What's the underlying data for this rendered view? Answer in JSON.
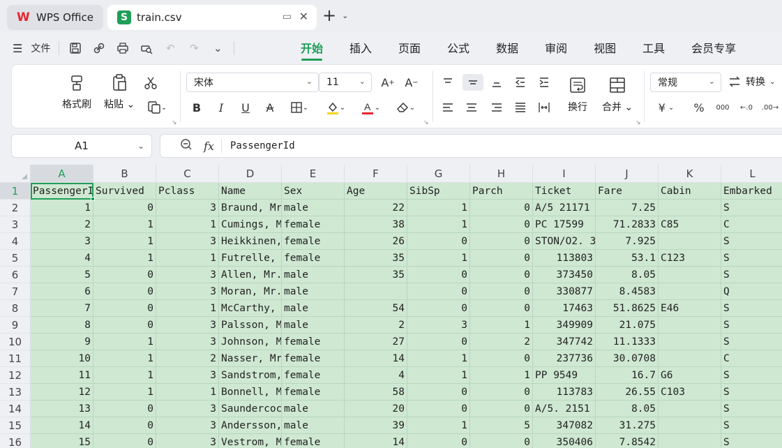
{
  "tabs": {
    "app": "WPS Office",
    "file": "train.csv"
  },
  "menu": {
    "file_label": "文件",
    "tabs": [
      "开始",
      "插入",
      "页面",
      "公式",
      "数据",
      "审阅",
      "视图",
      "工具",
      "会员专享"
    ],
    "active_tab": "开始"
  },
  "ribbon": {
    "format_painter": "格式刷",
    "paste": "粘贴",
    "font_name": "宋体",
    "font_size": "11",
    "wrap": "换行",
    "merge": "合并",
    "number_format": "常规",
    "convert": "转换",
    "currency": "¥",
    "percent": "%"
  },
  "formula_bar": {
    "name_box": "A1",
    "fx": "fx",
    "value": "PassengerId"
  },
  "sheet": {
    "columns": [
      "A",
      "B",
      "C",
      "D",
      "E",
      "F",
      "G",
      "H",
      "I",
      "J",
      "K",
      "L"
    ],
    "row_numbers": [
      "1",
      "2",
      "3",
      "4",
      "5",
      "6",
      "7",
      "8",
      "9",
      "10",
      "11",
      "12",
      "13",
      "14",
      "15",
      "16"
    ],
    "rows": [
      [
        "PassengerId",
        "Survived",
        "Pclass",
        "Name",
        "Sex",
        "Age",
        "SibSp",
        "Parch",
        "Ticket",
        "Fare",
        "Cabin",
        "Embarked"
      ],
      [
        "1",
        "0",
        "3",
        "Braund, Mr",
        "male",
        "22",
        "1",
        "0",
        "A/5 21171",
        "7.25",
        "",
        "S"
      ],
      [
        "2",
        "1",
        "1",
        "Cumings, M",
        "female",
        "38",
        "1",
        "0",
        "PC 17599",
        "71.2833",
        "C85",
        "C"
      ],
      [
        "3",
        "1",
        "3",
        "Heikkinen,",
        "female",
        "26",
        "0",
        "0",
        "STON/O2. 3",
        "7.925",
        "",
        "S"
      ],
      [
        "4",
        "1",
        "1",
        "Futrelle,",
        "female",
        "35",
        "1",
        "0",
        "113803",
        "53.1",
        "C123",
        "S"
      ],
      [
        "5",
        "0",
        "3",
        "Allen, Mr.",
        "male",
        "35",
        "0",
        "0",
        "373450",
        "8.05",
        "",
        "S"
      ],
      [
        "6",
        "0",
        "3",
        "Moran, Mr.",
        "male",
        "",
        "0",
        "0",
        "330877",
        "8.4583",
        "",
        "Q"
      ],
      [
        "7",
        "0",
        "1",
        "McCarthy,",
        "male",
        "54",
        "0",
        "0",
        "17463",
        "51.8625",
        "E46",
        "S"
      ],
      [
        "8",
        "0",
        "3",
        "Palsson, M",
        "male",
        "2",
        "3",
        "1",
        "349909",
        "21.075",
        "",
        "S"
      ],
      [
        "9",
        "1",
        "3",
        "Johnson, M",
        "female",
        "27",
        "0",
        "2",
        "347742",
        "11.1333",
        "",
        "S"
      ],
      [
        "10",
        "1",
        "2",
        "Nasser, Mr",
        "female",
        "14",
        "1",
        "0",
        "237736",
        "30.0708",
        "",
        "C"
      ],
      [
        "11",
        "1",
        "3",
        "Sandstrom,",
        "female",
        "4",
        "1",
        "1",
        "PP 9549",
        "16.7",
        "G6",
        "S"
      ],
      [
        "12",
        "1",
        "1",
        "Bonnell, M",
        "female",
        "58",
        "0",
        "0",
        "113783",
        "26.55",
        "C103",
        "S"
      ],
      [
        "13",
        "0",
        "3",
        "Saundercoc",
        "male",
        "20",
        "0",
        "0",
        "A/5. 2151",
        "8.05",
        "",
        "S"
      ],
      [
        "14",
        "0",
        "3",
        "Andersson,",
        "male",
        "39",
        "1",
        "5",
        "347082",
        "31.275",
        "",
        "S"
      ],
      [
        "15",
        "0",
        "3",
        "Vestrom, M",
        "female",
        "14",
        "0",
        "0",
        "350406",
        "7.8542",
        "",
        "S"
      ]
    ]
  },
  "colors": {
    "accent": "#1e9e56",
    "cell_fill": "#cfe8d2",
    "wps_red": "#e8262d"
  },
  "icons": {
    "format_painter": "brush-icon",
    "paste": "clipboard-icon",
    "cut": "scissors-icon",
    "copy": "copy-icon",
    "bold": "bold-icon",
    "italic": "italic-icon",
    "underline": "underline-icon",
    "strikethrough": "strikethrough-icon",
    "border": "border-icon",
    "fill": "fill-color-icon",
    "font_color": "font-color-icon",
    "clear": "eraser-icon"
  }
}
